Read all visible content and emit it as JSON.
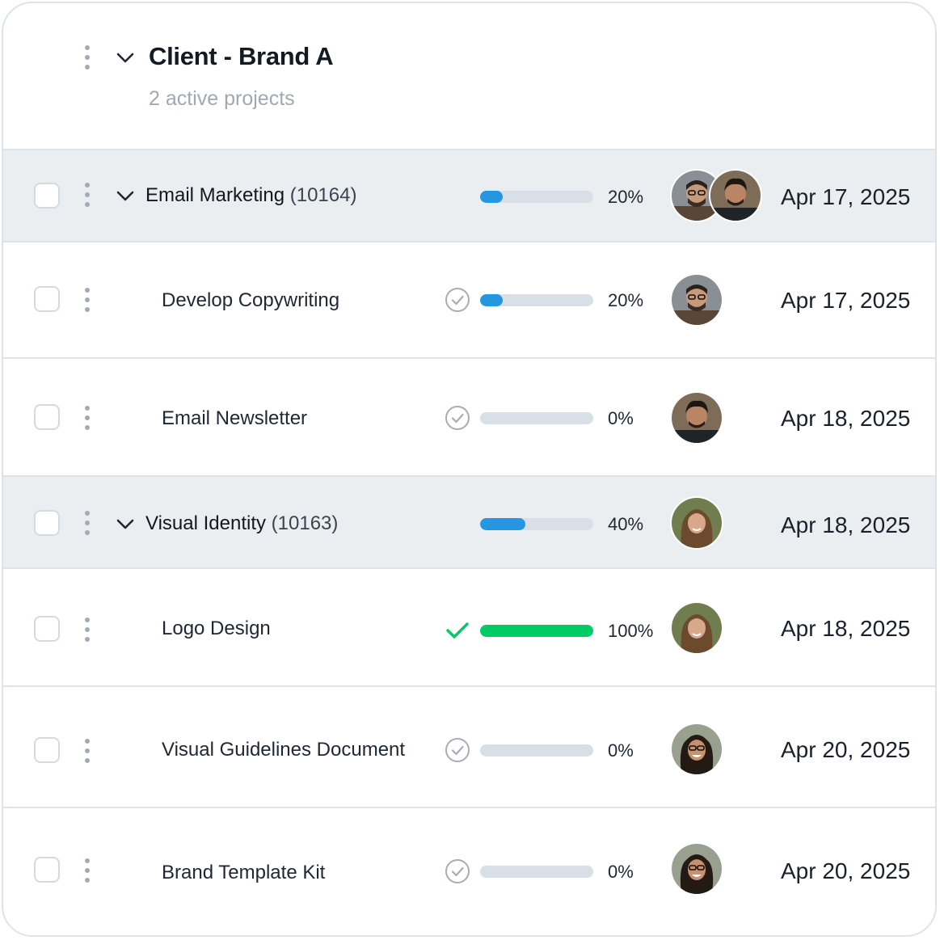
{
  "client": {
    "title": "Client - Brand A",
    "subtitle": "2 active projects"
  },
  "colors": {
    "progress_blue": "#2596e0",
    "progress_complete": "#00cc66",
    "group_row_bg": "#ebeef1"
  },
  "rows": [
    {
      "type": "group",
      "name": "Email Marketing",
      "id": "(10164)",
      "progress": "20%",
      "progress_fraction": 0.2,
      "date": "Apr 17, 2025",
      "avatars": [
        "man-glasses",
        "man-curly"
      ]
    },
    {
      "type": "task",
      "name": "Develop Copywriting",
      "status_icon": "circle-check-icon",
      "progress": "20%",
      "progress_fraction": 0.2,
      "date": "Apr 17, 2025",
      "avatars": [
        "man-glasses"
      ]
    },
    {
      "type": "task",
      "name": "Email Newsletter",
      "status_icon": "circle-check-icon",
      "progress": "0%",
      "progress_fraction": 0,
      "date": "Apr 18, 2025",
      "avatars": [
        "man-curly"
      ]
    },
    {
      "type": "group",
      "name": "Visual Identity",
      "id": "(10163)",
      "progress": "40%",
      "progress_fraction": 0.4,
      "date": "Apr 18, 2025",
      "avatars": [
        "woman-wavy"
      ]
    },
    {
      "type": "task",
      "name": "Logo Design",
      "status_icon": "checkmark-icon",
      "progress": "100%",
      "progress_fraction": 1,
      "date": "Apr 18, 2025",
      "avatars": [
        "woman-wavy"
      ]
    },
    {
      "type": "task",
      "name": "Visual Guidelines Document",
      "status_icon": "circle-check-icon",
      "progress": "0%",
      "progress_fraction": 0,
      "date": "Apr 20, 2025",
      "avatars": [
        "woman-glasses"
      ]
    },
    {
      "type": "task",
      "name": "Brand Template Kit",
      "status_icon": "circle-check-icon",
      "progress": "0%",
      "progress_fraction": 0,
      "date": "Apr 20, 2025",
      "avatars": [
        "woman-glasses"
      ]
    }
  ]
}
